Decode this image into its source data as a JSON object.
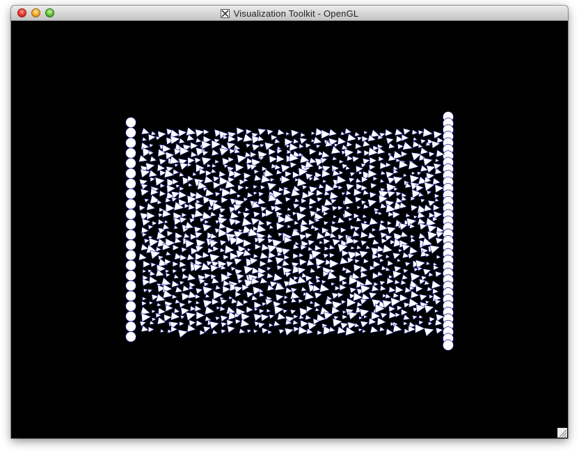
{
  "window": {
    "title": "Visualization Toolkit - OpenGL",
    "controls": [
      "close",
      "minimize",
      "zoom"
    ],
    "title_icon": "x11-icon",
    "colors": {
      "close": "#e0342a",
      "minimize": "#f1a724",
      "zoom": "#5fbf34",
      "background": "#000000",
      "glyph_fill": "#ffffff",
      "glyph_edge": "#1a1a8c"
    }
  },
  "scene": {
    "left_column_glyph": "sphere-glyph",
    "right_column_glyph": "sphere-glyph",
    "field_glyph": "triangle-arrow-glyph"
  }
}
